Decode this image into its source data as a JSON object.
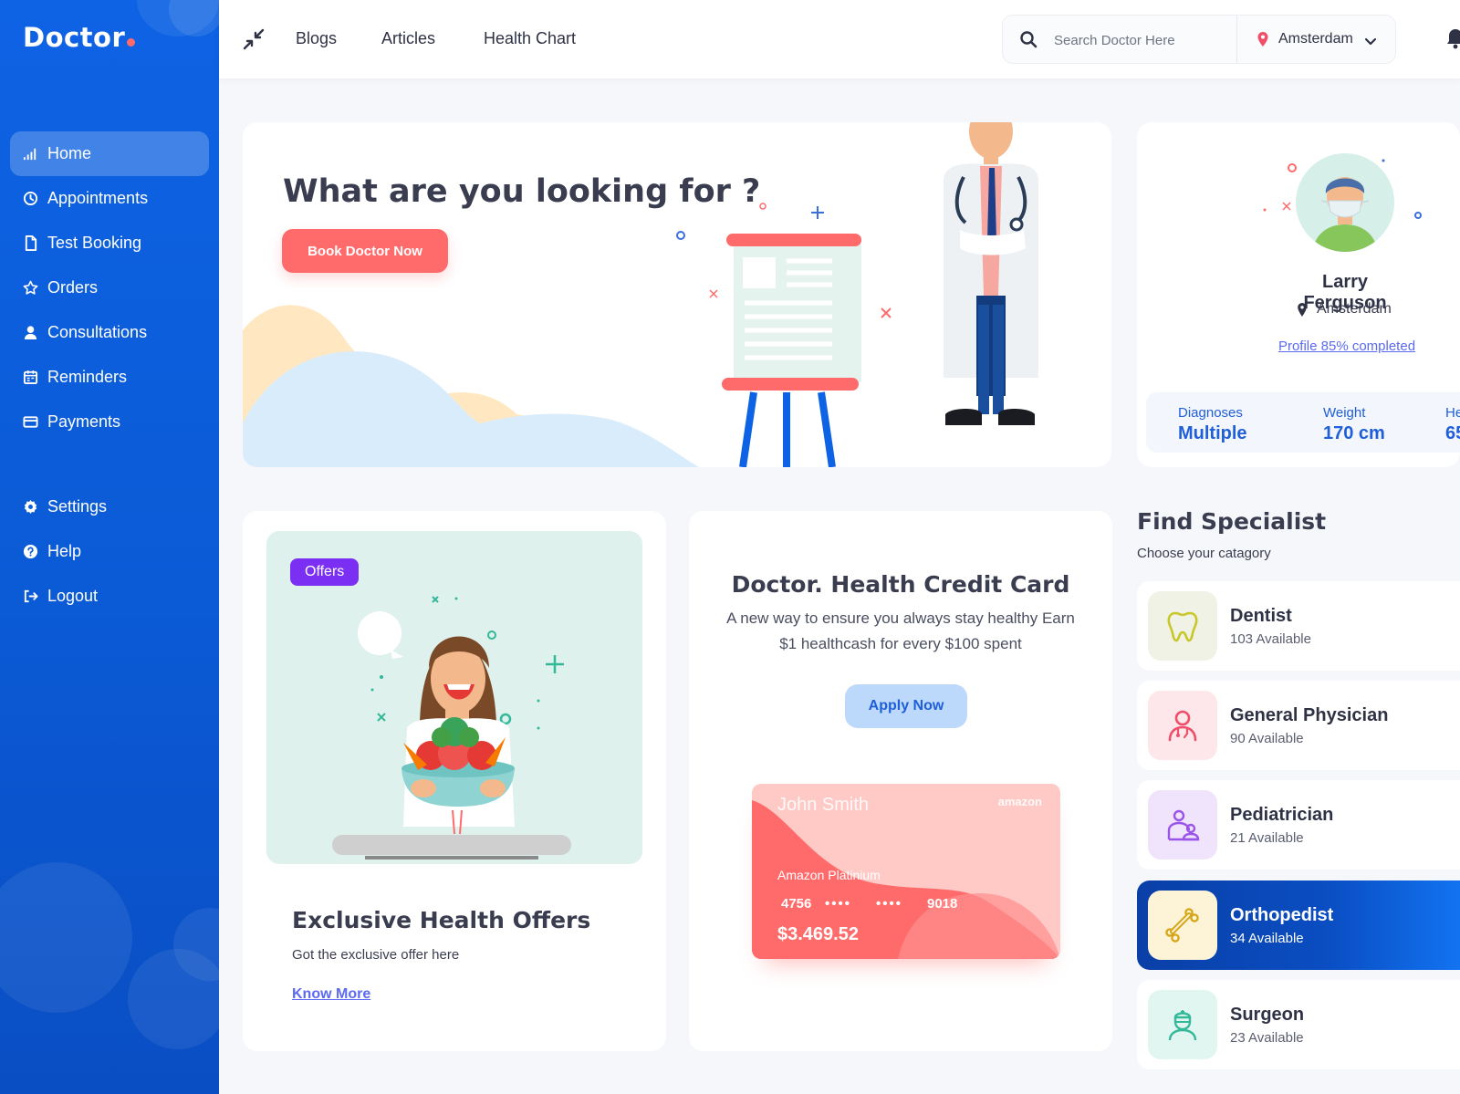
{
  "brand": {
    "logo": "Doctor"
  },
  "sidebar": {
    "items": [
      {
        "label": "Home",
        "icon": "chart-bars-icon",
        "active": true
      },
      {
        "label": "Appointments",
        "icon": "clock-icon"
      },
      {
        "label": "Test Booking",
        "icon": "document-icon"
      },
      {
        "label": "Orders",
        "icon": "star-icon"
      },
      {
        "label": "Consultations",
        "icon": "user-icon"
      },
      {
        "label": "Reminders",
        "icon": "calendar-icon"
      },
      {
        "label": "Payments",
        "icon": "card-icon"
      }
    ],
    "bottom_items": [
      {
        "label": "Settings",
        "icon": "gear-icon"
      },
      {
        "label": "Help",
        "icon": "help-icon"
      },
      {
        "label": "Logout",
        "icon": "logout-icon"
      }
    ]
  },
  "topbar": {
    "links": [
      "Blogs",
      "Articles",
      "Health Chart"
    ],
    "search_placeholder": "Search Doctor Here",
    "location": "Amsterdam"
  },
  "hero": {
    "title": "What are you looking for ?",
    "button": "Book Doctor Now"
  },
  "profile": {
    "name": "Larry Ferguson",
    "location": "Amsterdam",
    "completion_link": "Profile 85% completed",
    "completion_percent": 85,
    "stats": [
      {
        "label": "Diagnoses",
        "value": "Multiple"
      },
      {
        "label": "Weight",
        "value": "170 cm"
      },
      {
        "label": "He",
        "value": "65"
      }
    ]
  },
  "offers": {
    "badge": "Offers",
    "title": "Exclusive Health Offers",
    "subtitle": "Got the exclusive offer here",
    "link": "Know More"
  },
  "credit": {
    "title": "Doctor. Health Credit Card",
    "description": "A new way to ensure you always stay healthy Earn $1 healthcash for every $100 spent",
    "button": "Apply Now",
    "card": {
      "holder": "John Smith",
      "brand": "amazon",
      "type": "Amazon Platinium",
      "num_start": "4756",
      "mask1": "••••",
      "mask2": "••••",
      "num_end": "9018",
      "balance": "$3.469.52"
    }
  },
  "specialists": {
    "title": "Find Specialist",
    "subtitle": "Choose your catagory",
    "items": [
      {
        "name": "Dentist",
        "count": "103 Available",
        "icon": "tooth-icon",
        "bg": "#f1f2e6",
        "color": "#c9c62a"
      },
      {
        "name": "General Physician",
        "count": "90 Available",
        "icon": "physician-icon",
        "bg": "#fde7ea",
        "color": "#ef4f6a"
      },
      {
        "name": "Pediatrician",
        "count": "21 Available",
        "icon": "family-icon",
        "bg": "#efe4fb",
        "color": "#9a55e8"
      },
      {
        "name": "Orthopedist",
        "count": "34 Available",
        "icon": "bone-icon",
        "bg": "#fdf4d8",
        "color": "#d6a61b",
        "active": true
      },
      {
        "name": "Surgeon",
        "count": "23 Available",
        "icon": "surgeon-icon",
        "bg": "#e2f6f1",
        "color": "#33b99a"
      }
    ]
  },
  "colors": {
    "primary": "#0e63e4",
    "coral": "#ff6b6b",
    "purple": "#7b2ff2",
    "link": "#5b6af0"
  }
}
